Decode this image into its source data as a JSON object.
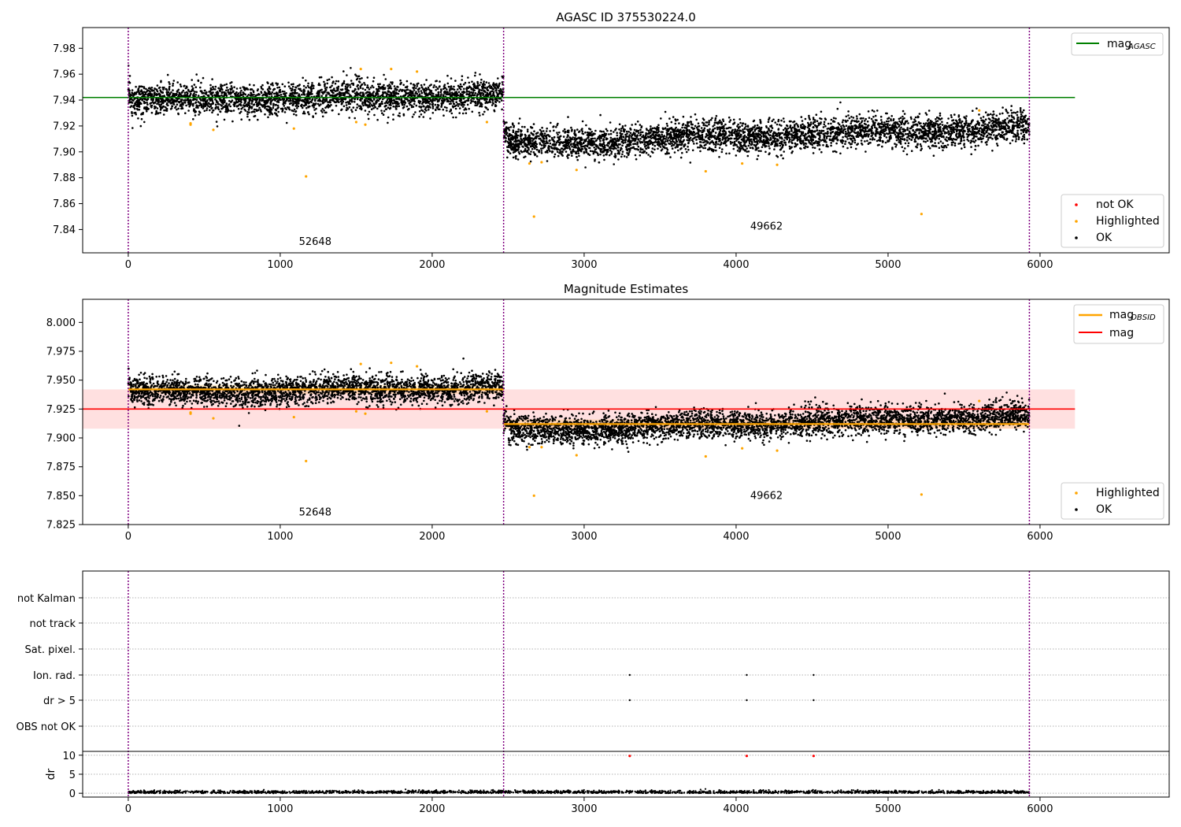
{
  "panels": [
    {
      "title": "AGASC ID 375530224.0",
      "y_ticks": [
        "7.84",
        "7.86",
        "7.88",
        "7.90",
        "7.92",
        "7.94",
        "7.96",
        "7.98"
      ],
      "x_ticks": [
        "0",
        "1000",
        "2000",
        "3000",
        "4000",
        "5000",
        "6000"
      ],
      "obs_labels": [
        "52648",
        "49662"
      ],
      "legend_top": {
        "label": "mag",
        "sub": "AGASC"
      },
      "legend_bottom": [
        "not OK",
        "Highlighted",
        "OK"
      ]
    },
    {
      "title": "Magnitude Estimates",
      "y_ticks": [
        "7.825",
        "7.850",
        "7.875",
        "7.900",
        "7.925",
        "7.950",
        "7.975",
        "8.000"
      ],
      "x_ticks": [
        "0",
        "1000",
        "2000",
        "3000",
        "4000",
        "5000",
        "6000"
      ],
      "obs_labels": [
        "52648",
        "49662"
      ],
      "legend_top": [
        {
          "label": "mag",
          "sub": "OBSID"
        },
        {
          "label": "mag",
          "sub": ""
        }
      ],
      "legend_bottom": [
        "Highlighted",
        "OK"
      ]
    },
    {
      "flag_labels": [
        "not Kalman",
        "not track",
        "Sat. pixel.",
        "Ion. rad.",
        "dr > 5",
        "OBS not OK"
      ],
      "dr_label": "dr",
      "dr_ticks": [
        "0",
        "5",
        "10"
      ],
      "x_ticks": [
        "0",
        "1000",
        "2000",
        "3000",
        "4000",
        "5000",
        "6000"
      ]
    }
  ],
  "colors": {
    "ok": "#000000",
    "highlighted": "#ffa500",
    "not_ok": "#ff0000",
    "agasc": "#008000",
    "mag": "#ff0000",
    "obsid_mag": "#ffa500",
    "boundary": "#800080"
  },
  "chart_data": [
    {
      "type": "scatter",
      "title": "AGASC ID 375530224.0",
      "xlim": [
        -300,
        6850
      ],
      "ylim": [
        7.822,
        7.996
      ],
      "obs_boundaries": [
        0,
        2470,
        5930
      ],
      "obs_labels": [
        {
          "text": "52648",
          "x": 1230,
          "y": 7.828
        },
        {
          "text": "49662",
          "x": 4200,
          "y": 7.84
        }
      ],
      "agasc_mag": {
        "value": 7.942,
        "x_range": [
          -300,
          6230
        ]
      },
      "segments": [
        {
          "x_range": [
            0,
            2470
          ],
          "mean_start": 7.939,
          "mean_end": 7.944,
          "sigma": 0.006
        },
        {
          "x_range": [
            2470,
            5930
          ],
          "mean_start": 7.906,
          "mean_end": 7.919,
          "sigma": 0.006
        }
      ],
      "highlighted": [
        [
          410,
          7.922
        ],
        [
          410,
          7.921
        ],
        [
          560,
          7.917
        ],
        [
          1090,
          7.918
        ],
        [
          1170,
          7.881
        ],
        [
          1500,
          7.923
        ],
        [
          1530,
          7.964
        ],
        [
          1560,
          7.921
        ],
        [
          1730,
          7.964
        ],
        [
          1900,
          7.962
        ],
        [
          2360,
          7.923
        ],
        [
          2640,
          7.891
        ],
        [
          2670,
          7.85
        ],
        [
          2720,
          7.892
        ],
        [
          2950,
          7.886
        ],
        [
          3800,
          7.885
        ],
        [
          4040,
          7.891
        ],
        [
          4270,
          7.89
        ],
        [
          5220,
          7.852
        ],
        [
          5600,
          7.932
        ]
      ],
      "legend": [
        "mag_AGASC",
        "not OK",
        "Highlighted",
        "OK"
      ]
    },
    {
      "type": "scatter",
      "title": "Magnitude Estimates",
      "xlim": [
        -300,
        6850
      ],
      "ylim": [
        7.825,
        8.02
      ],
      "obs_boundaries": [
        0,
        2470,
        5930
      ],
      "obs_labels": [
        {
          "text": "52648",
          "x": 1230,
          "y": 7.833
        },
        {
          "text": "49662",
          "x": 4200,
          "y": 7.847
        }
      ],
      "mag": {
        "value": 7.925,
        "band": [
          7.908,
          7.942
        ],
        "x_range": [
          -300,
          6230
        ]
      },
      "obsid_mag": [
        {
          "value": 7.942,
          "x_range": [
            0,
            2470
          ]
        },
        {
          "value": 7.912,
          "x_range": [
            2470,
            5930
          ]
        }
      ],
      "segments": [
        {
          "x_range": [
            0,
            2470
          ],
          "mean_start": 7.939,
          "mean_end": 7.944,
          "sigma": 0.006
        },
        {
          "x_range": [
            2470,
            5930
          ],
          "mean_start": 7.906,
          "mean_end": 7.919,
          "sigma": 0.006
        }
      ],
      "highlighted": [
        [
          410,
          7.922
        ],
        [
          410,
          7.921
        ],
        [
          560,
          7.917
        ],
        [
          1090,
          7.918
        ],
        [
          1170,
          7.88
        ],
        [
          1500,
          7.923
        ],
        [
          1530,
          7.964
        ],
        [
          1560,
          7.921
        ],
        [
          1730,
          7.965
        ],
        [
          1900,
          7.962
        ],
        [
          2360,
          7.923
        ],
        [
          2640,
          7.892
        ],
        [
          2670,
          7.85
        ],
        [
          2720,
          7.892
        ],
        [
          2950,
          7.885
        ],
        [
          3800,
          7.884
        ],
        [
          4040,
          7.891
        ],
        [
          4270,
          7.889
        ],
        [
          5220,
          7.851
        ],
        [
          5600,
          7.932
        ]
      ],
      "legend": [
        "mag_OBSID",
        "mag",
        "Highlighted",
        "OK"
      ]
    },
    {
      "type": "scatter",
      "xlim": [
        -300,
        6850
      ],
      "flags": [
        {
          "name": "not Kalman",
          "points": []
        },
        {
          "name": "not track",
          "points": []
        },
        {
          "name": "Sat. pixel.",
          "points": []
        },
        {
          "name": "Ion. rad.",
          "points": [
            3300,
            4070,
            4510
          ]
        },
        {
          "name": "dr > 5",
          "points": [
            3300,
            4070,
            4510
          ]
        },
        {
          "name": "OBS not OK",
          "points": []
        }
      ],
      "dr": {
        "ylim": [
          -1,
          11
        ],
        "ticks": [
          0,
          5,
          10
        ],
        "typical": 0.3,
        "spikes": [
          3300,
          4070,
          4510
        ],
        "spike_value": 9.8
      }
    }
  ]
}
